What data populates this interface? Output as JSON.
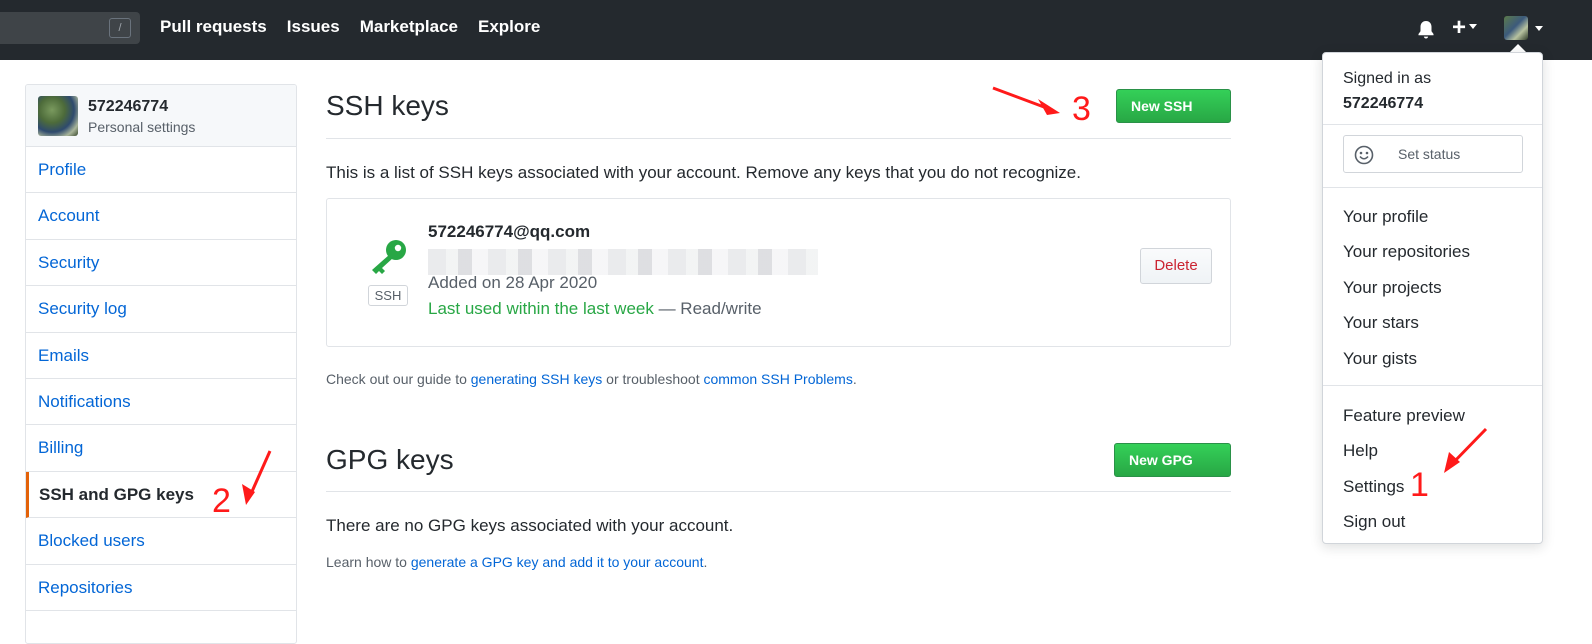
{
  "header": {
    "search_shortcut": "/",
    "nav": [
      "Pull requests",
      "Issues",
      "Marketplace",
      "Explore"
    ],
    "plus_label": "+"
  },
  "sidebar": {
    "username": "572246774",
    "subtitle": "Personal settings",
    "items": [
      {
        "label": "Profile",
        "active": false
      },
      {
        "label": "Account",
        "active": false
      },
      {
        "label": "Security",
        "active": false
      },
      {
        "label": "Security log",
        "active": false
      },
      {
        "label": "Emails",
        "active": false
      },
      {
        "label": "Notifications",
        "active": false
      },
      {
        "label": "Billing",
        "active": false
      },
      {
        "label": "SSH and GPG keys",
        "active": true
      },
      {
        "label": "Blocked users",
        "active": false
      },
      {
        "label": "Repositories",
        "active": false
      }
    ]
  },
  "ssh": {
    "title": "SSH keys",
    "new_button": "New SSH key",
    "intro": "This is a list of SSH keys associated with your account. Remove any keys that you do not recognize.",
    "key": {
      "badge": "SSH",
      "email": "572246774@qq.com",
      "added": "Added on 28 Apr 2020",
      "last_used": "Last used within the last week",
      "access": " — Read/write",
      "delete_button": "Delete"
    },
    "guide_prefix": "Check out our guide to ",
    "guide_link1": "generating SSH keys",
    "guide_middle": " or troubleshoot ",
    "guide_link2": "common SSH Problems",
    "guide_suffix": "."
  },
  "gpg": {
    "title": "GPG keys",
    "new_button": "New GPG key",
    "empty": "There are no GPG keys associated with your account.",
    "learn_prefix": "Learn how to ",
    "learn_link": "generate a GPG key and add it to your account",
    "learn_suffix": "."
  },
  "dropdown": {
    "signed_in_as": "Signed in as",
    "username": "572246774",
    "set_status": "Set status",
    "group1": [
      "Your profile",
      "Your repositories",
      "Your projects",
      "Your stars",
      "Your gists"
    ],
    "group2": [
      "Feature preview",
      "Help",
      "Settings",
      "Sign out"
    ]
  },
  "annotations": {
    "one": "1",
    "two": "2",
    "three": "3"
  },
  "colors": {
    "header_bg": "#24292e",
    "link": "#0366d6",
    "green": "#28a745",
    "danger": "#cb2431",
    "active_border": "#e36209",
    "annotation": "#ff1a1a"
  }
}
